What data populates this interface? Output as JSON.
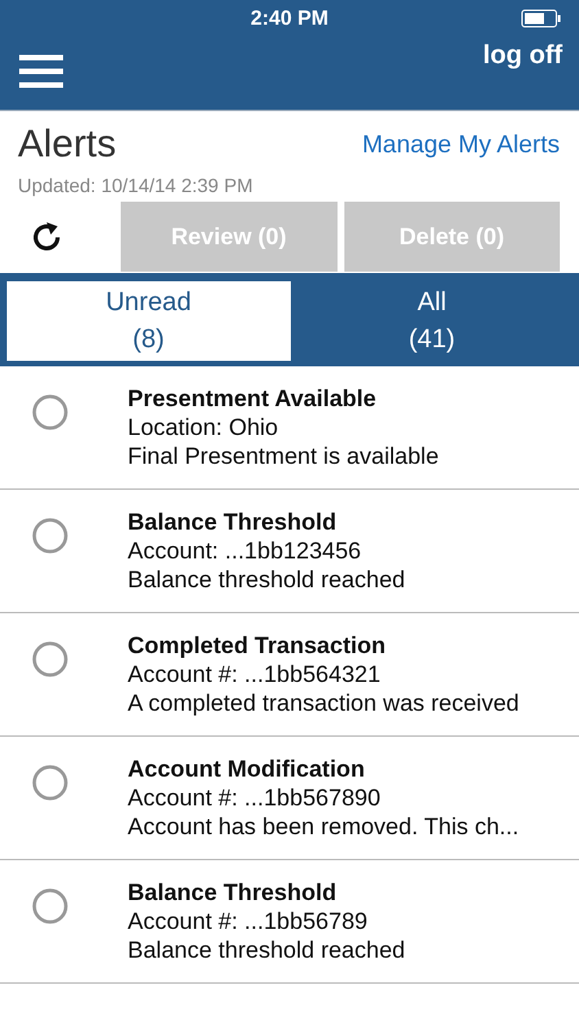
{
  "status_bar": {
    "time": "2:40 PM"
  },
  "header": {
    "logoff": "log off"
  },
  "title": "Alerts",
  "manage_link": "Manage My Alerts",
  "updated": "Updated: 10/14/14 2:39 PM",
  "actions": [
    {
      "label": "Review (0)",
      "disabled": true
    },
    {
      "label": "Delete (0)",
      "disabled": true
    }
  ],
  "tabs": [
    {
      "label": "Unread",
      "count": "(8)",
      "selected": true
    },
    {
      "label": "All",
      "count": "(41)",
      "selected": false
    }
  ],
  "alerts": [
    {
      "title": "Presentment Available",
      "line1": "Location: Ohio",
      "line2": "Final Presentment is available",
      "checked": false
    },
    {
      "title": "Balance Threshold",
      "line1": "Account: ...1bb123456",
      "line2": "Balance threshold reached",
      "checked": false
    },
    {
      "title": "Completed Transaction",
      "line1": "Account #: ...1bb564321",
      "line2": "A completed transaction was received",
      "checked": false
    },
    {
      "title": "Account Modification",
      "line1": "Account #: ...1bb567890",
      "line2": "Account has been removed. This ch...",
      "checked": false
    },
    {
      "title": "Balance Threshold",
      "line1": "Account #: ...1bb56789",
      "line2": "Balance threshold reached",
      "checked": false
    }
  ]
}
